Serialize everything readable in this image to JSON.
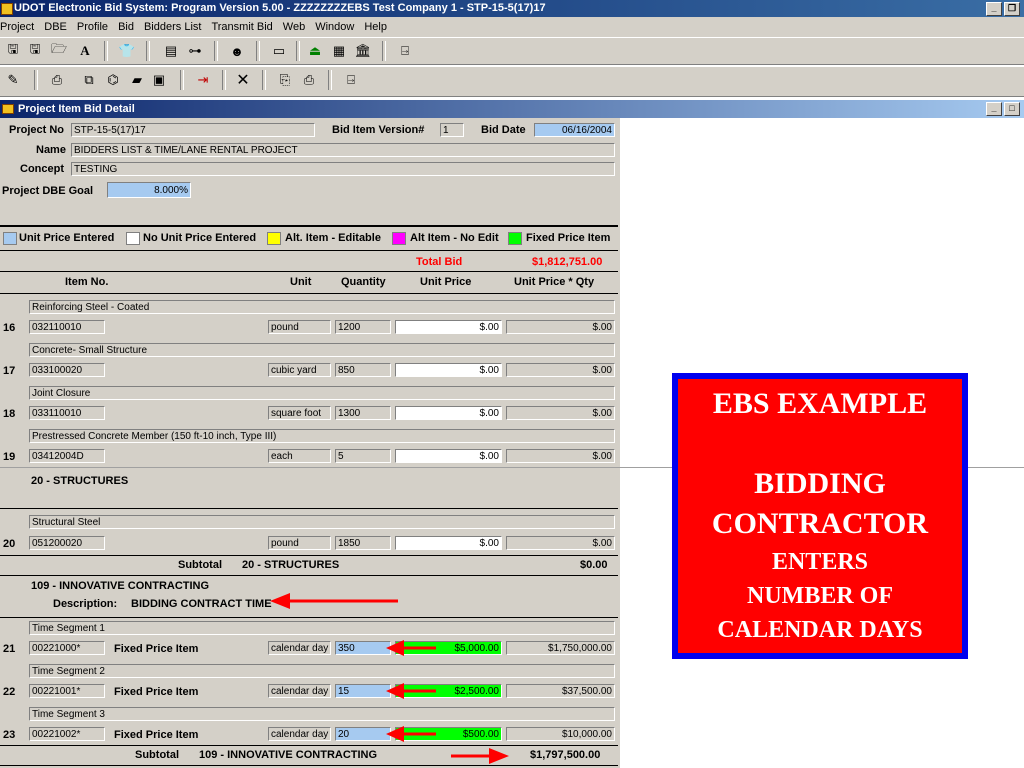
{
  "window": {
    "title": "UDOT Electronic Bid System:  Program Version 5.00  - ZZZZZZZZEBS Test Company 1 - STP-15-5(17)17"
  },
  "menu": [
    "Project",
    "DBE",
    "Profile",
    "Bid",
    "Bidders List",
    "Transmit Bid",
    "Web",
    "Window",
    "Help"
  ],
  "toolbar1_icons": [
    "save-icon",
    "save-as-icon",
    "open-folder-icon",
    "font-icon",
    "shirt-icon",
    "list-view-icon",
    "link-icon",
    "user-search-icon",
    "form-icon",
    "upload-icon",
    "image-icon",
    "bank-icon",
    "exit-door-icon"
  ],
  "toolbar2_icons": [
    "edit-icon",
    "print-icon",
    "copy-icon",
    "chart-icon",
    "report-icon",
    "table-icon",
    "door-in-icon",
    "delete-icon",
    "paste-icon",
    "printer-icon",
    "exit-door-icon"
  ],
  "child_window": {
    "title": "Project Item Bid Detail"
  },
  "project": {
    "project_no_label": "Project No",
    "project_no": "STP-15-5(17)17",
    "bid_version_label": "Bid Item Version#",
    "bid_version": "1",
    "bid_date_label": "Bid Date",
    "bid_date": "06/16/2004",
    "name_label": "Name",
    "name": "BIDDERS LIST & TIME/LANE RENTAL PROJECT",
    "concept_label": "Concept",
    "concept": "TESTING",
    "dbe_goal_label": "Project DBE Goal",
    "dbe_goal": "8.000%"
  },
  "legend": {
    "unit_price_entered": "Unit Price Entered",
    "no_unit_price_entered": "No Unit Price Entered",
    "alt_editable": "Alt. Item - Editable",
    "alt_no_edit": "Alt Item - No Edit",
    "fixed_price": "Fixed Price Item",
    "colors": {
      "unit_price_entered": "#a6caf0",
      "no_unit_price_entered": "#ffffff",
      "alt_editable": "#ffff00",
      "alt_no_edit": "#ff00ff",
      "fixed_price": "#00ff00"
    }
  },
  "totals": {
    "total_bid_label": "Total Bid",
    "total_bid": "$1,812,751.00"
  },
  "columns": {
    "item_no": "Item No.",
    "unit": "Unit",
    "quantity": "Quantity",
    "unit_price": "Unit Price",
    "extended": "Unit Price * Qty"
  },
  "items": [
    {
      "line": "16",
      "desc": "Reinforcing Steel - Coated",
      "item_no": "032110010",
      "unit": "pound",
      "qty": "1200",
      "price": "$.00",
      "ext": "$.00"
    },
    {
      "line": "17",
      "desc": "Concrete- Small Structure",
      "item_no": "033100020",
      "unit": "cubic yard",
      "qty": "850",
      "price": "$.00",
      "ext": "$.00"
    },
    {
      "line": "18",
      "desc": "Joint Closure",
      "item_no": "033110010",
      "unit": "square foot",
      "qty": "1300",
      "price": "$.00",
      "ext": "$.00"
    },
    {
      "line": "19",
      "desc": "Prestressed Concrete Member (150 ft-10 inch, Type III)",
      "item_no": "03412004D",
      "unit": "each",
      "qty": "5",
      "price": "$.00",
      "ext": "$.00"
    }
  ],
  "section_structures": {
    "title": "20 - STRUCTURES"
  },
  "item20": {
    "line": "20",
    "desc": "Structural Steel",
    "item_no": "051200020",
    "unit": "pound",
    "qty": "1850",
    "price": "$.00",
    "ext": "$.00"
  },
  "subtotal1": {
    "label": "Subtotal",
    "section": "20 - STRUCTURES",
    "value": "$0.00"
  },
  "section_innovative": {
    "title": "109 - INNOVATIVE CONTRACTING",
    "desc_label": "Description:",
    "desc": "BIDDING CONTRACT TIME"
  },
  "time_items": [
    {
      "line": "21",
      "desc": "Time Segment 1",
      "item_no": "00221000*",
      "kind": "Fixed Price Item",
      "unit": "calendar day",
      "qty": "350",
      "price": "$5,000.00",
      "ext": "$1,750,000.00"
    },
    {
      "line": "22",
      "desc": "Time Segment 2",
      "item_no": "00221001*",
      "kind": "Fixed Price Item",
      "unit": "calendar day",
      "qty": "15",
      "price": "$2,500.00",
      "ext": "$37,500.00"
    },
    {
      "line": "23",
      "desc": "Time Segment 3",
      "item_no": "00221002*",
      "kind": "Fixed Price Item",
      "unit": "calendar day",
      "qty": "20",
      "price": "$500.00",
      "ext": "$10,000.00"
    }
  ],
  "subtotal2": {
    "label": "Subtotal",
    "section": "109 - INNOVATIVE CONTRACTING",
    "value": "$1,797,500.00"
  },
  "callout": {
    "line1": "EBS EXAMPLE",
    "line2": "BIDDING",
    "line3": "CONTRACTOR",
    "line4": "ENTERS",
    "line5": "NUMBER OF",
    "line6": "CALENDAR DAYS"
  },
  "colors": {
    "accent_red": "#ff0000",
    "callout_border": "#0000ee",
    "title_blue": "#0a246a"
  }
}
